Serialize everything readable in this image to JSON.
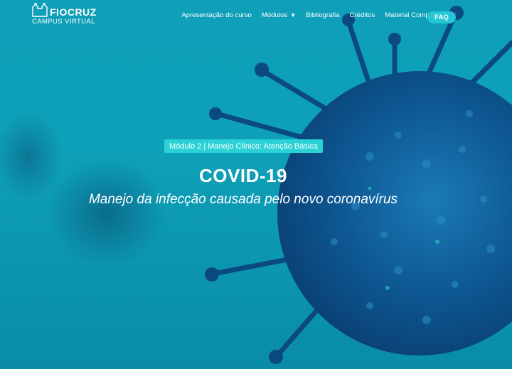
{
  "brand": {
    "name": "FIOCRUZ",
    "subtitle": "CAMPUS VIRTUAL"
  },
  "nav": {
    "items": [
      {
        "label": "Apresentação do curso"
      },
      {
        "label": "Módulos"
      },
      {
        "label": "Bibliografia"
      },
      {
        "label": "Créditos"
      },
      {
        "label": "Material Complementar"
      }
    ],
    "faq_label": "FAQ"
  },
  "hero": {
    "badge": "Módulo 2 | Manejo Clínico: Atenção Básica",
    "title": "COVID-19",
    "subtitle": "Manejo da infecção causada pelo novo coronavírus"
  },
  "colors": {
    "background": "#0ea0b8",
    "accent": "#2ad2d6",
    "faq_button": "#25c7d6",
    "virus": "#0d4f86"
  },
  "icons": {
    "logo": "building-icon",
    "modules_dropdown": "chevron-down-icon"
  }
}
